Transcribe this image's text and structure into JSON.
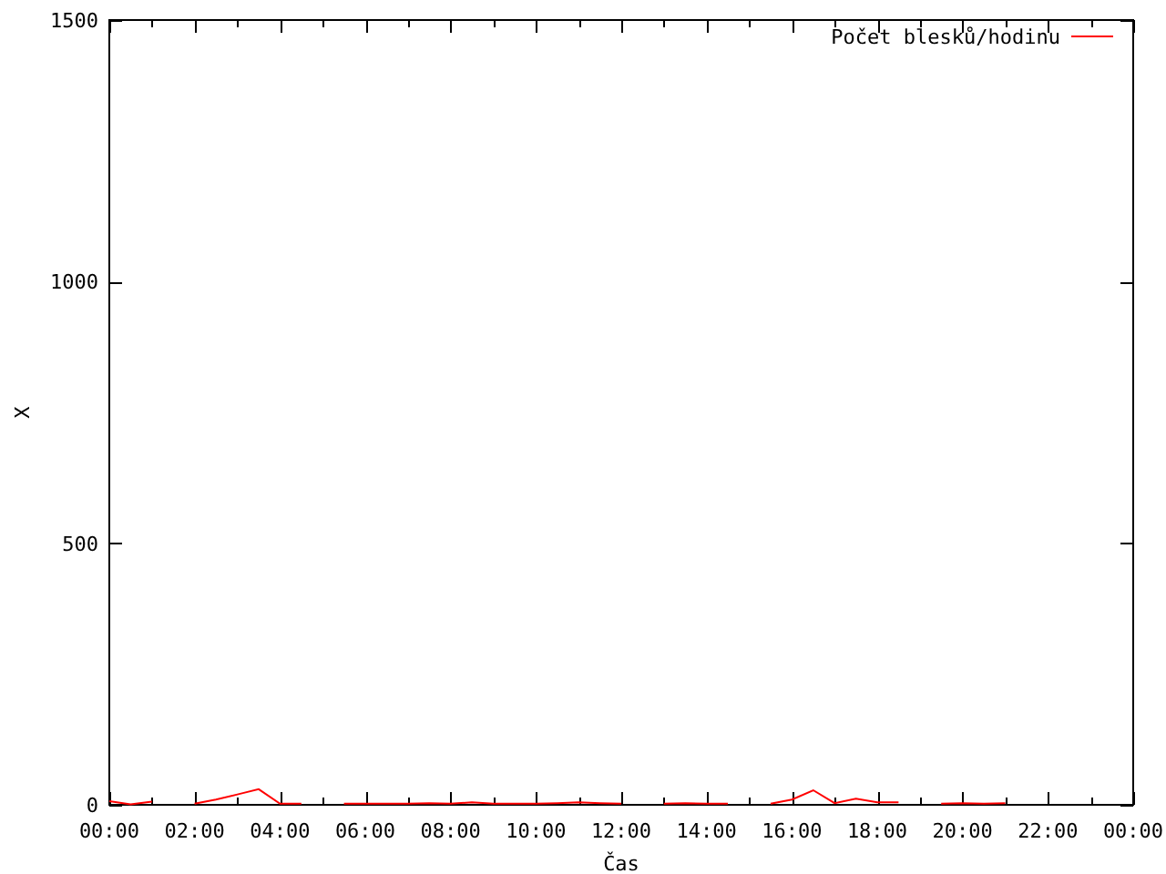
{
  "chart_data": {
    "type": "line",
    "xlabel": "Čas",
    "ylabel": "X",
    "xlim": [
      0,
      24
    ],
    "ylim": [
      0,
      1500
    ],
    "xticks": [
      {
        "value": 0,
        "label": "00:00"
      },
      {
        "value": 2,
        "label": "02:00"
      },
      {
        "value": 4,
        "label": "04:00"
      },
      {
        "value": 6,
        "label": "06:00"
      },
      {
        "value": 8,
        "label": "08:00"
      },
      {
        "value": 10,
        "label": "10:00"
      },
      {
        "value": 12,
        "label": "12:00"
      },
      {
        "value": 14,
        "label": "14:00"
      },
      {
        "value": 16,
        "label": "16:00"
      },
      {
        "value": 18,
        "label": "18:00"
      },
      {
        "value": 20,
        "label": "20:00"
      },
      {
        "value": 22,
        "label": "22:00"
      },
      {
        "value": 24,
        "label": "00:00"
      }
    ],
    "yticks": [
      0,
      500,
      1000,
      1500
    ],
    "x": [
      0,
      0.5,
      1,
      2,
      2.5,
      3,
      3.5,
      4,
      4.5,
      5.5,
      6,
      6.5,
      7,
      7.5,
      8,
      8.5,
      9,
      9.5,
      10,
      10.5,
      11,
      11.5,
      12,
      13,
      13.5,
      14,
      14.5,
      15.5,
      16,
      16.5,
      17,
      17.5,
      18,
      18.5,
      19.5,
      20,
      20.5,
      21
    ],
    "series": [
      {
        "name": "Počet blesků/hodinu",
        "color": "#ff0000",
        "values": [
          7,
          1,
          6,
          2,
          10,
          20,
          30,
          2,
          2,
          2,
          2,
          2,
          2,
          3,
          2,
          5,
          2,
          2,
          2,
          3,
          5,
          3,
          2,
          2,
          3,
          2,
          2,
          2,
          10,
          28,
          3,
          12,
          5,
          5,
          2,
          3,
          2,
          3
        ]
      }
    ]
  }
}
